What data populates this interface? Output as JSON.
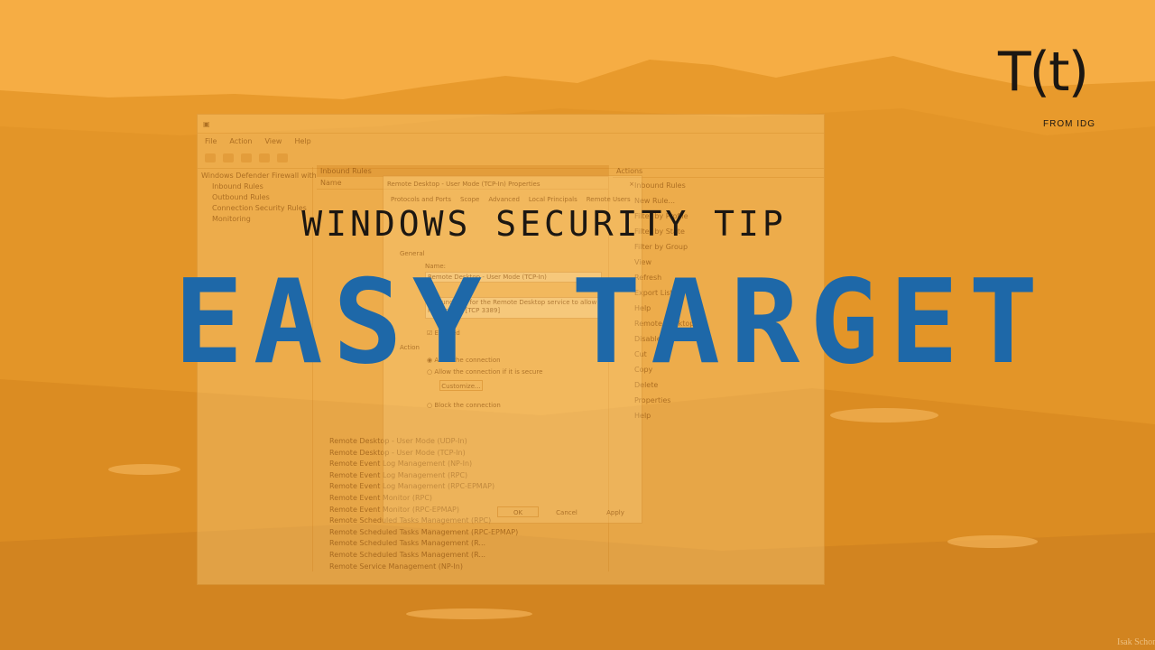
{
  "overlay": {
    "kicker": "WINDOWS SECURITY TIP",
    "headline": "EASY TARGET"
  },
  "logo": {
    "mark": "T(t)",
    "from": "FROM IDG"
  },
  "credit": "Isak Schorn",
  "window": {
    "menu": [
      "File",
      "Action",
      "View",
      "Help"
    ],
    "tree": [
      "Windows Defender Firewall with",
      "Inbound Rules",
      "Outbound Rules",
      "Connection Security Rules",
      "Monitoring"
    ],
    "mid_header": "Inbound Rules",
    "mid_column": "Name",
    "rows": [
      "Remote Desktop - User Mode (UDP-In)",
      "Remote Desktop - User Mode (TCP-In)",
      "Remote Event Log Management (NP-In)",
      "Remote Event Log Management (RPC)",
      "Remote Event Log Management (RPC-EPMAP)",
      "Remote Event Monitor (RPC)",
      "Remote Event Monitor (RPC-EPMAP)",
      "Remote Scheduled Tasks Management (RPC)",
      "Remote Scheduled Tasks Management (RPC-EPMAP)",
      "Remote Scheduled Tasks Management (R...",
      "Remote Scheduled Tasks Management (R...",
      "Remote Service Management (NP-In)"
    ],
    "actions_header": "Actions",
    "actions": [
      "Inbound Rules",
      "New Rule...",
      "Filter by Profile",
      "Filter by State",
      "Filter by Group",
      "View",
      "Refresh",
      "Export List...",
      "Help",
      "Remote Desktop",
      "Disable Rule",
      "Cut",
      "Copy",
      "Delete",
      "Properties",
      "Help"
    ]
  },
  "dialog": {
    "title": "Remote Desktop - User Mode (TCP-In) Properties",
    "close": "×",
    "tabs": [
      "Protocols and Ports",
      "Scope",
      "Advanced",
      "Local Principals",
      "Remote Users"
    ],
    "general": "General",
    "name_label": "Name:",
    "name_value": "Remote Desktop - User Mode (TCP-In)",
    "description": "Inbound rule for the Remote Desktop service to allow RDP traffic. [TCP 3389]",
    "enabled": "Enabled",
    "action": "Action",
    "allow": "Allow the connection",
    "allow_secure": "Allow the connection if it is secure",
    "customize": "Customize...",
    "block": "Block the connection",
    "ok": "OK",
    "cancel": "Cancel",
    "apply": "Apply"
  }
}
